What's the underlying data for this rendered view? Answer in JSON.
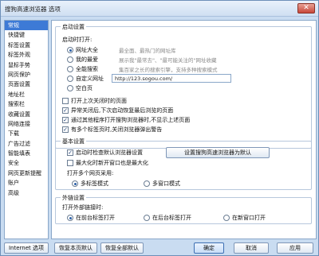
{
  "window": {
    "title": "搜狗高速浏览器 选项",
    "close_glyph": "✕"
  },
  "sidebar": {
    "items": [
      {
        "label": "常规",
        "active": true
      },
      {
        "label": "快捷键"
      },
      {
        "label": "标签设置"
      },
      {
        "label": "标签外观"
      },
      {
        "label": "鼠标手势"
      },
      {
        "label": "网页保护"
      },
      {
        "label": "页面设置"
      },
      {
        "label": "地址栏"
      },
      {
        "label": "搜索栏"
      },
      {
        "label": "收藏设置"
      },
      {
        "label": "网络连接"
      },
      {
        "label": "下载"
      },
      {
        "label": "广告过滤"
      },
      {
        "label": "智能填表"
      },
      {
        "label": "安全"
      },
      {
        "label": "网页更新提醒"
      },
      {
        "label": "账户"
      },
      {
        "label": "高级"
      }
    ]
  },
  "startup": {
    "group_label": "启动设置",
    "on_start_label": "启动时打开:",
    "options": [
      {
        "label": "网址大全",
        "hint": "最全面、最热门的网址库",
        "selected": true
      },
      {
        "label": "我的最爱",
        "hint": "展示我\"最常去\"、\"最可能关注的\"网址收藏"
      },
      {
        "label": "全能搜索",
        "hint": "集百家之长的搜索引擎，支持多种搜索模式"
      },
      {
        "label": "自定义网址"
      },
      {
        "label": "空白页"
      }
    ],
    "custom_url": "http://123.sogou.com/",
    "checks": [
      {
        "label": "打开上次关闭时的页面",
        "checked": false
      },
      {
        "label": "异常关闭后,下次启动恢复最后浏览的页面",
        "checked": true
      },
      {
        "label": "通过其他程序打开搜狗浏览器时,不显示上述页面",
        "checked": true
      },
      {
        "label": "有多个标签页时,关闭浏览器弹出警告",
        "checked": true
      }
    ]
  },
  "basic": {
    "group_label": "基本设置",
    "checks": [
      {
        "label": "启动时检查默认浏览器设置",
        "checked": true
      },
      {
        "label": "最大化时新开窗口也是最大化",
        "checked": false
      }
    ],
    "default_button": "设置搜狗高速浏览器为默认",
    "multi_label": "打开多个网页采用:",
    "multi_options": [
      {
        "label": "多标签模式",
        "selected": true
      },
      {
        "label": "多窗口模式"
      }
    ]
  },
  "external": {
    "group_label": "外链设置",
    "open_label": "打开外部链接时:",
    "options": [
      {
        "label": "在前台标签打开",
        "selected": true
      },
      {
        "label": "在后台标签打开"
      },
      {
        "label": "在新窗口打开"
      }
    ]
  },
  "footer": {
    "internet_options": "Internet 选项",
    "restore_page": "恢复本页默认",
    "restore_all": "恢复全部默认",
    "ok": "确定",
    "cancel": "取消",
    "apply": "应用"
  }
}
